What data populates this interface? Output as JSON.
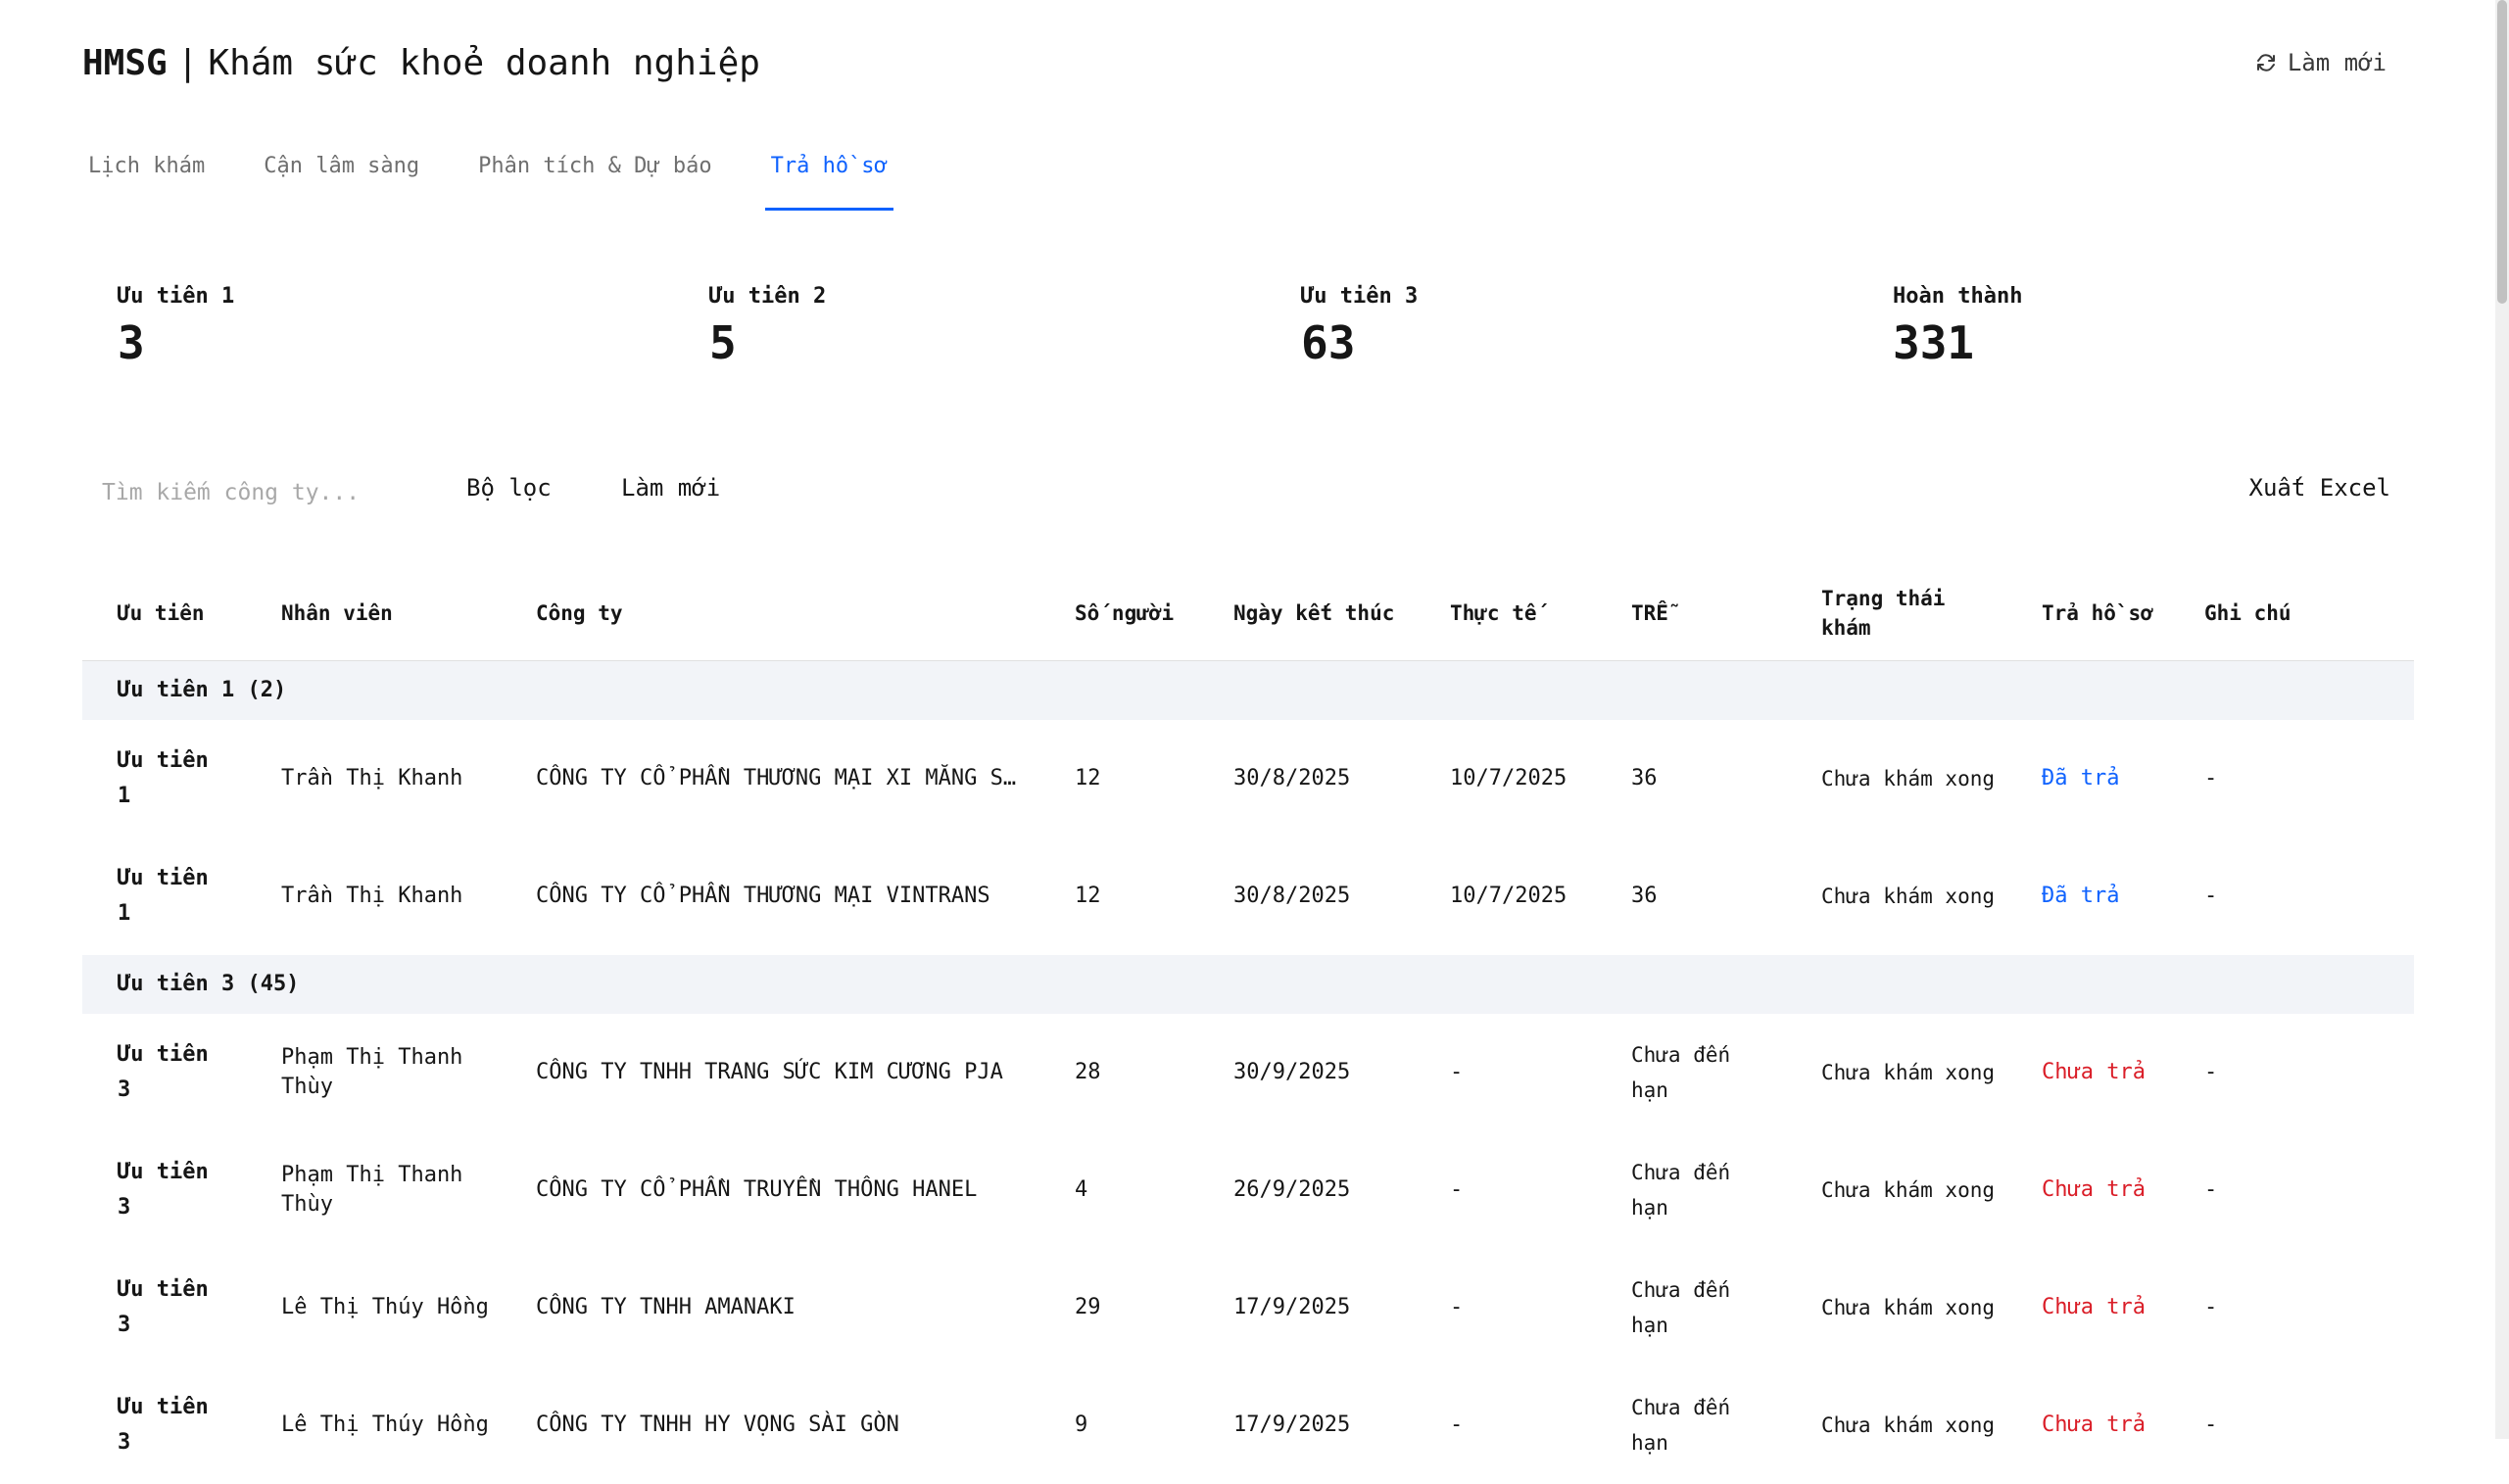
{
  "header": {
    "brand": "HMSG",
    "separator": "|",
    "title": "Khám sức khoẻ doanh nghiệp",
    "refresh_label": "Làm mới"
  },
  "tabs": [
    {
      "label": "Lịch khám"
    },
    {
      "label": "Cận lâm sàng"
    },
    {
      "label": "Phân tích & Dự báo"
    },
    {
      "label": "Trả hồ sơ"
    }
  ],
  "stats": [
    {
      "label": "Ưu tiên 1",
      "value": "3"
    },
    {
      "label": "Ưu tiên 2",
      "value": "5"
    },
    {
      "label": "Ưu tiên 3",
      "value": "63"
    },
    {
      "label": "Hoàn thành",
      "value": "331"
    }
  ],
  "toolbar": {
    "search_placeholder": "Tìm kiếm công ty...",
    "filter_label": "Bộ lọc",
    "refresh_label": "Làm mới",
    "export_label": "Xuất Excel"
  },
  "table": {
    "headers": [
      "Ưu tiên",
      "Nhân viên",
      "Công ty",
      "Số người",
      "Ngày kết thúc",
      "Thực tế",
      "TRỄ",
      "Trạng thái khám",
      "Trả hồ sơ",
      "Ghi chú"
    ],
    "groups": [
      {
        "label": "Ưu tiên 1 (2)",
        "rows": [
          {
            "priority": "Ưu tiên 1",
            "staff": "Trần Thị Khanh",
            "company": "CÔNG TY CỔ PHẦN THƯƠNG MẠI XI MĂNG SA…",
            "people": "12",
            "end_date": "30/8/2025",
            "actual": "10/7/2025",
            "late": "36",
            "status": "Chưa khám xong",
            "returned": "Đã trả",
            "note": "-"
          },
          {
            "priority": "Ưu tiên 1",
            "staff": "Trần Thị Khanh",
            "company": "CÔNG TY CỔ PHẦN THƯƠNG MẠI VINTRANS",
            "people": "12",
            "end_date": "30/8/2025",
            "actual": "10/7/2025",
            "late": "36",
            "status": "Chưa khám xong",
            "returned": "Đã trả",
            "note": "-"
          }
        ]
      },
      {
        "label": "Ưu tiên 3 (45)",
        "rows": [
          {
            "priority": "Ưu tiên 3",
            "staff": "Phạm Thị Thanh Thùy",
            "company": "CÔNG TY TNHH TRANG SỨC KIM CƯƠNG PJA",
            "people": "28",
            "end_date": "30/9/2025",
            "actual": "-",
            "late": "Chưa đến hạn",
            "status": "Chưa khám xong",
            "returned": "Chưa trả",
            "note": "-"
          },
          {
            "priority": "Ưu tiên 3",
            "staff": "Phạm Thị Thanh Thùy",
            "company": "CÔNG TY CỔ PHẦN TRUYỀN THÔNG HANEL",
            "people": "4",
            "end_date": "26/9/2025",
            "actual": "-",
            "late": "Chưa đến hạn",
            "status": "Chưa khám xong",
            "returned": "Chưa trả",
            "note": "-"
          },
          {
            "priority": "Ưu tiên 3",
            "staff": "Lê Thị Thúy Hồng",
            "company": "CÔNG TY TNHH AMANAKI",
            "people": "29",
            "end_date": "17/9/2025",
            "actual": "-",
            "late": "Chưa đến hạn",
            "status": "Chưa khám xong",
            "returned": "Chưa trả",
            "note": "-"
          },
          {
            "priority": "Ưu tiên 3",
            "staff": "Lê Thị Thúy Hồng",
            "company": "CÔNG TY TNHH HY VỌNG SÀI GÒN",
            "people": "9",
            "end_date": "17/9/2025",
            "actual": "-",
            "late": "Chưa đến hạn",
            "status": "Chưa khám xong",
            "returned": "Chưa trả",
            "note": "-"
          }
        ]
      }
    ]
  }
}
